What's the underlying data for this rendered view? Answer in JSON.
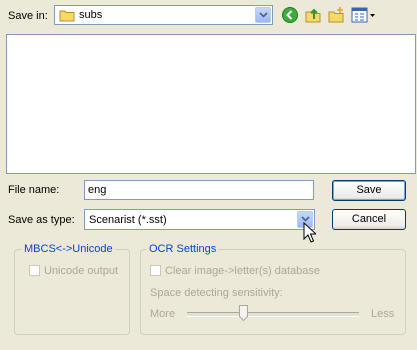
{
  "save_in": {
    "label": "Save in:",
    "value": "subs"
  },
  "file_name": {
    "label": "File name:",
    "value": "eng"
  },
  "save_as_type": {
    "label": "Save as type:",
    "value": "Scenarist (*.sst)"
  },
  "buttons": {
    "save": "Save",
    "cancel": "Cancel"
  },
  "mbcs_group": {
    "title": "MBCS<->Unicode",
    "unicode_output": "Unicode output",
    "unicode_checked": false
  },
  "ocr_group": {
    "title": "OCR Settings",
    "clear_db": "Clear image->letter(s) database",
    "clear_checked": false,
    "sensitivity_label": "Space detecting sensitivity:",
    "more": "More",
    "less": "Less",
    "sensitivity_level": 0.33
  },
  "colors": {
    "group_title": "#0046d5",
    "disabled_text": "#aca899",
    "window_bg": "#ece9d8"
  },
  "toolbar_icons": [
    "back-icon",
    "up-folder-icon",
    "new-folder-icon",
    "view-menu-icon"
  ]
}
